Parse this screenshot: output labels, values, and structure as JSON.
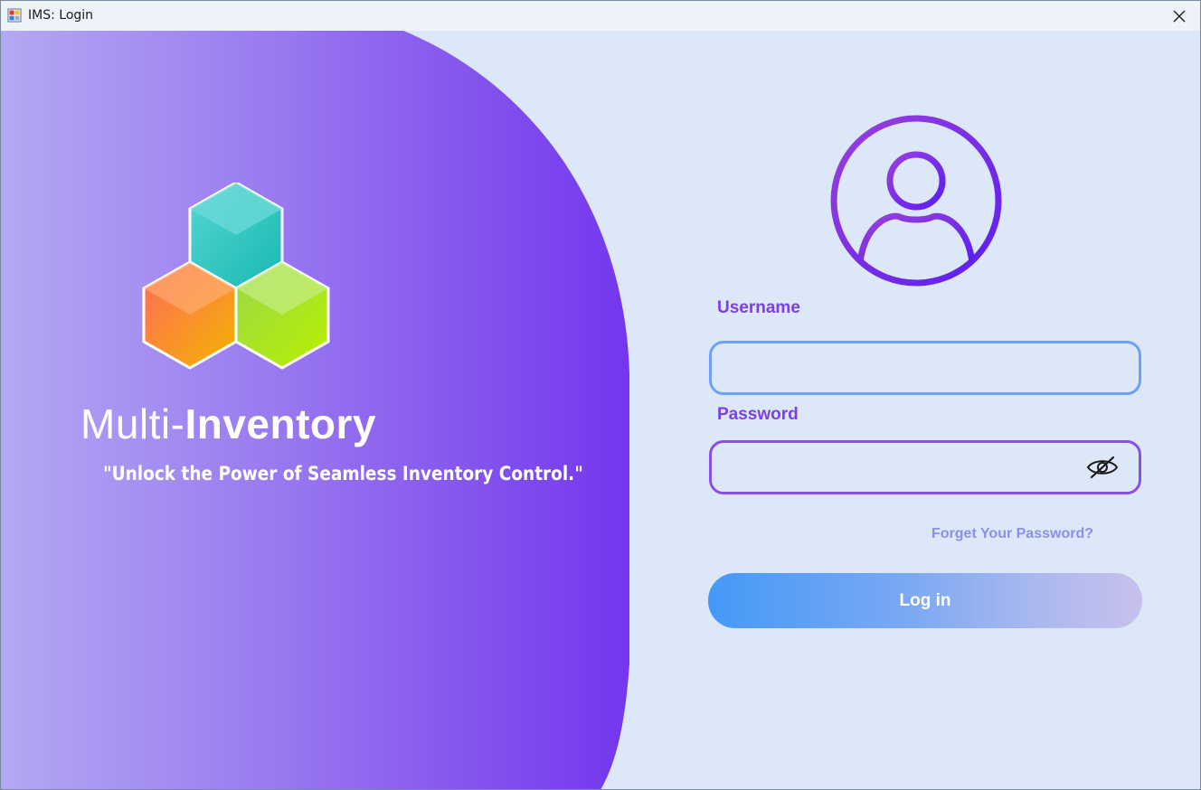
{
  "window": {
    "title": "IMS: Login",
    "close_icon": "close-icon"
  },
  "brand": {
    "name_light": "Multi-",
    "name_bold": "Inventory",
    "tagline": "\"Unlock the Power of  Seamless Inventory Control.\"",
    "logo_icon": "hexagon-cubes-logo"
  },
  "form": {
    "avatar_icon": "user-avatar-icon",
    "username_label": "Username",
    "username_value": "",
    "password_label": "Password",
    "password_value": "",
    "password_toggle_icon": "eye-slash-icon",
    "forgot_link": "Forget Your Password?",
    "login_button": "Log in"
  },
  "colors": {
    "background": "#dce8f7",
    "accent_purple": "#7b3fe4",
    "panel_gradient_start": "#b4a8f3",
    "panel_gradient_end": "#7436ee",
    "username_border": "#6fa0f5",
    "password_border": "#8a4fe6",
    "link": "#8c8fe6",
    "button_gradient_start": "#4499f7",
    "button_gradient_end": "#c8c0ee"
  }
}
